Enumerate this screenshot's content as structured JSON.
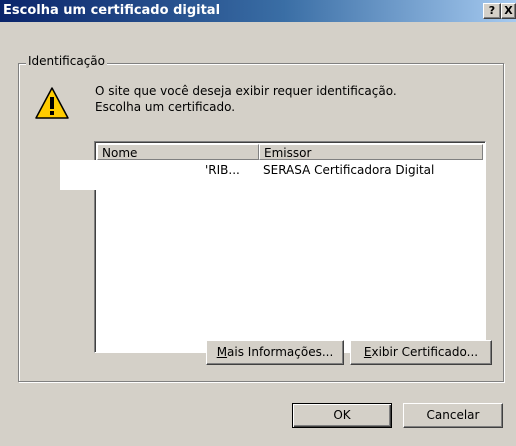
{
  "window": {
    "title": "Escolha um certificado digital",
    "help_label": "?",
    "close_label": "X"
  },
  "group": {
    "label": "Identificação",
    "message_line1": "O site que você deseja exibir requer identificação.",
    "message_line2": "Escolha um certificado.",
    "icon": "warning-icon"
  },
  "certificates": {
    "columns": [
      "Nome",
      "Emissor"
    ],
    "rows": [
      {
        "name": "'RIB...",
        "issuer": "SERASA Certificadora Digital"
      }
    ]
  },
  "buttons": {
    "mais_prefix": "",
    "mais_key": "M",
    "mais_rest": "ais Informações...",
    "exibir_key": "E",
    "exibir_rest": "xibir Certificado...",
    "ok": "OK",
    "cancel": "Cancelar"
  },
  "colors": {
    "face": "#d4d0c8",
    "title_start": "#0a246a",
    "title_end": "#a6caf0",
    "warning": "#ffcc00"
  }
}
